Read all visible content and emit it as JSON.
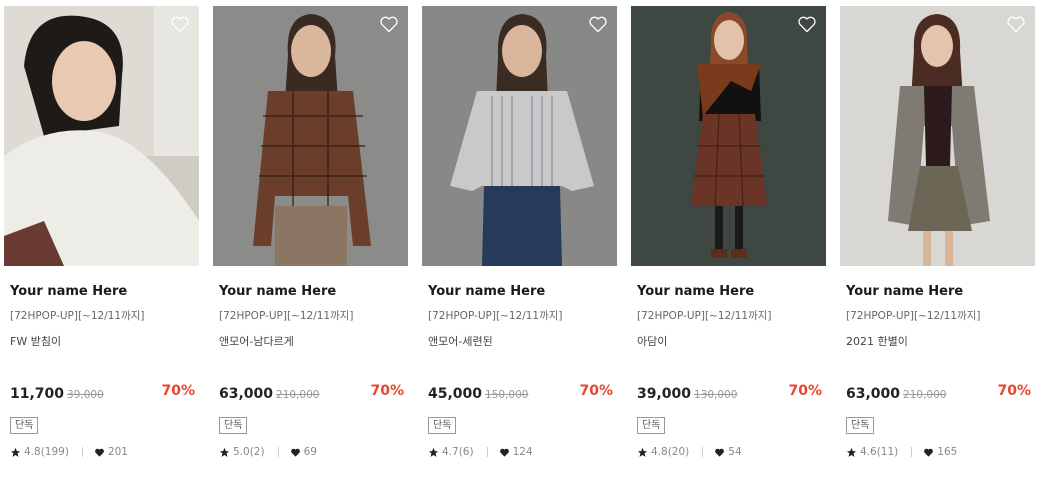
{
  "products": [
    {
      "brand": "Your name Here",
      "tag": "[72HPOP-UP][~12/11까지]",
      "name": "FW 받침이",
      "price": "11,700",
      "original_price": "39,000",
      "discount": "70%",
      "badge": "단독",
      "rating": "4.8(199)",
      "likes": "201",
      "bg": "#d9d6cf"
    },
    {
      "brand": "Your name Here",
      "tag": "[72HPOP-UP][~12/11까지]",
      "name": "앤모어-남다르게",
      "price": "63,000",
      "original_price": "210,000",
      "discount": "70%",
      "badge": "단독",
      "rating": "5.0(2)",
      "likes": "69",
      "bg": "#8a8a88"
    },
    {
      "brand": "Your name Here",
      "tag": "[72HPOP-UP][~12/11까지]",
      "name": "앤모어-세련된",
      "price": "45,000",
      "original_price": "150,000",
      "discount": "70%",
      "badge": "단독",
      "rating": "4.7(6)",
      "likes": "124",
      "bg": "#878786"
    },
    {
      "brand": "Your name Here",
      "tag": "[72HPOP-UP][~12/11까지]",
      "name": "아담이",
      "price": "39,000",
      "original_price": "130,000",
      "discount": "70%",
      "badge": "단독",
      "rating": "4.8(20)",
      "likes": "54",
      "bg": "#3d4640"
    },
    {
      "brand": "Your name Here",
      "tag": "[72HPOP-UP][~12/11까지]",
      "name": "2021 한별이",
      "price": "63,000",
      "original_price": "210,000",
      "discount": "70%",
      "badge": "단독",
      "rating": "4.6(11)",
      "likes": "165",
      "bg": "#d8d6d2"
    }
  ],
  "colors": {
    "discount": "#e8452c",
    "text": "#222222",
    "muted": "#888888"
  }
}
